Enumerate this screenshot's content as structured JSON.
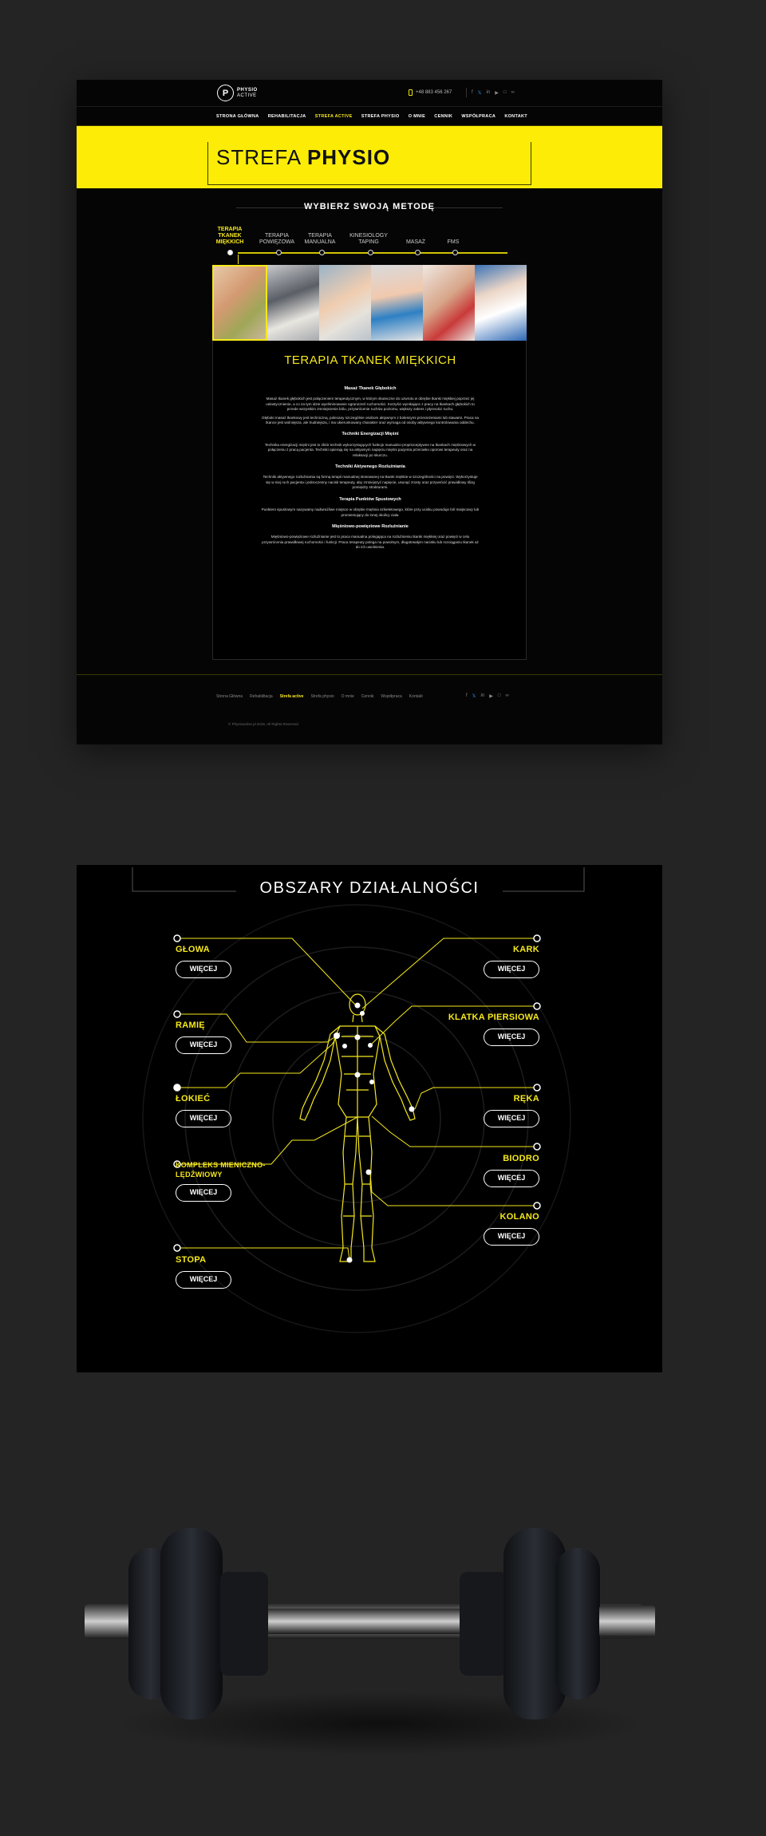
{
  "site": {
    "logo": {
      "mark": "P",
      "line1": "PHYSIO",
      "line2": "ACTIVE"
    },
    "phone": "+48 883 456 267",
    "social_icons": [
      "facebook-icon",
      "twitter-icon",
      "linkedin-icon",
      "youtube-icon",
      "instagram-icon",
      "link-icon"
    ],
    "nav": [
      "STRONA GŁÓWNA",
      "REHABILITACJA",
      "STREFA ACTIVE",
      "STREFA PHYSIO",
      "O MNIE",
      "CENNIK",
      "WSPÓŁPRACA",
      "KONTAKT"
    ],
    "nav_active_index": 2,
    "hero": {
      "title_light": "STREFA",
      "title_bold": "PHYSIO"
    },
    "choose_heading": "WYBIERZ SWOJĄ METODĘ",
    "methods": [
      {
        "label": "TERAPIA TKANEK MIĘKKICH",
        "active": true
      },
      {
        "label": "TERAPIA POWIĘZOWA",
        "active": false
      },
      {
        "label": "TERAPIA MANUALNA",
        "active": false
      },
      {
        "label": "KINESIOLOGY TAPING",
        "active": false
      },
      {
        "label": "MASAŻ",
        "active": false
      },
      {
        "label": "FMS",
        "active": false
      }
    ],
    "content": {
      "title": "TERAPIA TKANEK MIĘKKICH",
      "sections": [
        {
          "heading": "Masaż Tkanek Głębokich",
          "paragraphs": [
            "Masaż tkanek głębokich jest połączeniem terapeutycznym, w którym skuteczne do uzwrotu w obrębie tkanki miękkiej poprzez jej uelastycznienie, a co za tym idzie wyeliminowanie ograniczeń ruchomości. Korzyści wynikające z pracy na tkankach głębokich to przede wszystkim zmniejszenie bólu, przywrócenie ruchów poziomu, większy zakres i płynności ruchu.",
            "Głęboki masaż tkankowy jest techniczną, polecany szczególnie osobom aktywnym z bolesnymi przecieżeniami lub stawami. Praca na tkance jest wolniejsza, ale trudniejsza, i ma ukierunkowany charakter oraz wymaga od osoby aktywnego kontrolowania oddechu."
          ]
        },
        {
          "heading": "Techniki Energizacji Mięśni",
          "paragraphs": [
            "Technika energizacji mięśni jest to zbiór technik wykorzystujących funkcje manualno-proprioceptywne na tkankach mięśniowych w połączeniu z pracą pacjenta. Techniki opierają się na aktywnym napięciu mięśni pacjenta przeciwko oporowi terapeuty oraz na relaksacji po skurczu."
          ]
        },
        {
          "heading": "Techniki Aktywnego Rozluźniania",
          "paragraphs": [
            "Techniki aktywnego rozluźniania są formą terapii manualnej stosowanej na tkanki miękkie w szczególności na powięzi. Wykorzystuje się w niej ruch pacjenta i jednoczesny nacisk terapeuty, aby zmniejszyć napięcie, usunąć zrosty oraz przywrócić prawidłowy ślizg pomiędzy strukturami."
          ]
        },
        {
          "heading": "Terapia Punktów Spustowych",
          "paragraphs": [
            "Punktem spustowym nazywamy nadwrażliwe miejsce w obrębie mięśnia szkieletowego, które przy ucisku powoduje ból miejscowy lub promieniujący do innej okolicy ciała."
          ]
        },
        {
          "heading": "Mięśniowo-powięziowe Rozluźnianie",
          "paragraphs": [
            "Mięśniowo-powięziowe rozluźnianie jest to praca manualna polegająca na rozluźnieniu tkanki miękkiej oraz powięzi w celu przywrócenia prawidłowej ruchomości i funkcji. Praca terapeuty polega na powolnym, długotrwałym nacisku lub rozciąganiu tkanek aż do ich uwolnienia."
          ]
        }
      ]
    },
    "footer_nav": [
      "Strona Główna",
      "Rehabilitacja",
      "Strefa active",
      "Strefa physio",
      "O mnie",
      "Cennik",
      "Współpraca",
      "Kontakt"
    ],
    "footer_active_index": 2,
    "copyright": "© Physioactive.pl 2016. All Rights Reserved."
  },
  "areas": {
    "title": "OBSZARY DZIAŁALNOŚCI",
    "button_label": "WIĘCEJ",
    "left": [
      "GŁOWA",
      "RAMIĘ",
      "ŁOKIEĆ",
      "KOMPLEKS MIENICZNO-LĘDŹWIOWY",
      "STOPA"
    ],
    "right": [
      "KARK",
      "KLATKA PIERSIOWA",
      "RĘKA",
      "BIODRO",
      "KOLANO"
    ]
  },
  "colors": {
    "accent": "#fcec06",
    "background": "#242424",
    "panel": "#000000"
  }
}
